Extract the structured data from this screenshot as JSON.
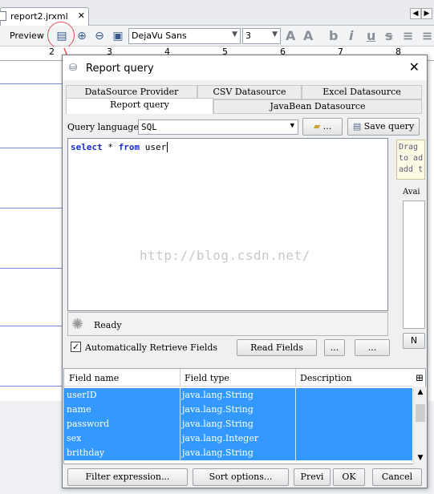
{
  "editor": {
    "tab_title": "report2.jrxml",
    "preview_label": "Preview",
    "font_family_value": "DejaVu Sans",
    "font_size_value": "3",
    "ruler_ticks": [
      "2",
      "3",
      "4",
      "5",
      "6",
      "7",
      "8"
    ]
  },
  "dialog": {
    "title": "Report query",
    "close_label": "✕",
    "tabs_row1": [
      "DataSource Provider",
      "CSV Datasource",
      "Excel Datasource"
    ],
    "tabs_row2": [
      "Report query",
      "JavaBean Datasource"
    ],
    "query_language_label": "Query language",
    "query_language_value": "SQL",
    "open_button_label": "...",
    "save_query_label": "Save query",
    "query_keyword_1": "select",
    "query_mid": " * ",
    "query_keyword_2": "from",
    "query_tail": " user",
    "watermark": "http://blog.csdn.net/",
    "status_text": "Ready",
    "hint_text": "Drag\nto ad\nadd t",
    "available_label": "Avai",
    "mini_button_label": "N",
    "auto_retrieve_label": "Automatically Retrieve Fields",
    "read_fields_label": "Read Fields",
    "dots_label_1": "...",
    "dots_label_2": "...",
    "columns": [
      "Field name",
      "Field type",
      "Description"
    ],
    "rows": [
      {
        "name": "userID",
        "type": "java.lang.String"
      },
      {
        "name": "name",
        "type": "java.lang.String"
      },
      {
        "name": "password",
        "type": "java.lang.String"
      },
      {
        "name": "sex",
        "type": "java.lang.Integer"
      },
      {
        "name": "brithday",
        "type": "java.lang.String"
      }
    ],
    "filter_button": "Filter expression...",
    "sort_button": "Sort options...",
    "preview_button": "Previ",
    "ok_button": "OK",
    "cancel_button": "Cancel"
  },
  "colors": {
    "selection": "#3399ff",
    "keyword": "#1a2bd0",
    "annotation": "#e0525a"
  }
}
